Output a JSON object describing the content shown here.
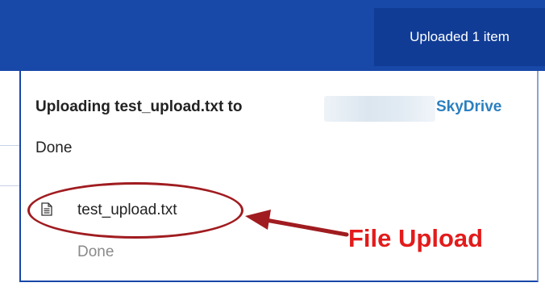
{
  "header": {
    "status_text": "Uploaded 1 item"
  },
  "upload": {
    "title_prefix": "Uploading test_upload.txt to",
    "destination": "SkyDrive",
    "overall_status": "Done",
    "file_name": "test_upload.txt",
    "file_status": "Done",
    "file_icon": "document-icon"
  },
  "annotation": {
    "label": "File Upload",
    "color": "#e31b1b",
    "ellipse_color": "#a01c20"
  },
  "colors": {
    "brand_blue": "#1848a8",
    "status_blue": "#103c96",
    "link_blue": "#2b7fbf"
  }
}
